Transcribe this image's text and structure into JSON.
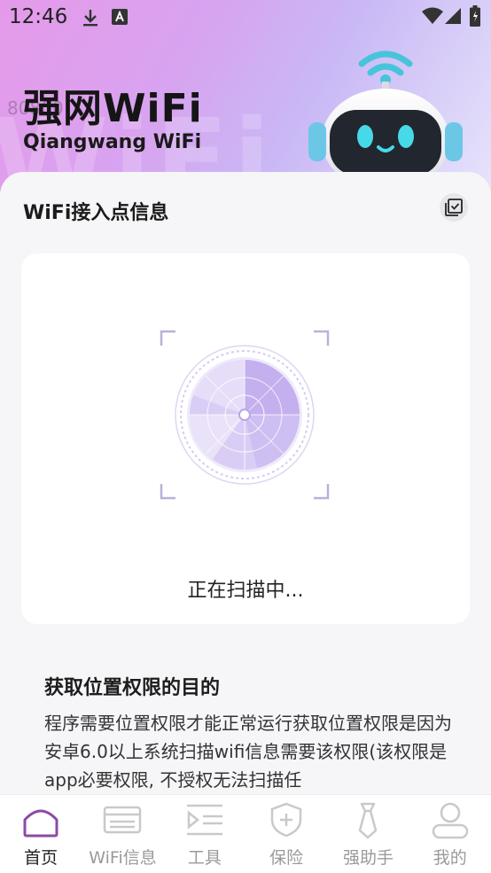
{
  "status_bar": {
    "time": "12:46"
  },
  "header": {
    "title": "强网WiFi",
    "subtitle": "Qiangwang WiFi",
    "faint_text": "80800"
  },
  "section": {
    "title": "WiFi接入点信息"
  },
  "scan": {
    "status_text": "正在扫描中..."
  },
  "permission": {
    "title": "获取位置权限的目的",
    "body": "程序需要位置权限才能正常运行获取位置权限是因为安卓6.0以上系统扫描wifi信息需要该权限(该权限是app必要权限, 不授权无法扫描任"
  },
  "tabs": [
    {
      "label": "首页",
      "icon": "home-icon"
    },
    {
      "label": "WiFi信息",
      "icon": "wifi-info-icon"
    },
    {
      "label": "工具",
      "icon": "tools-icon"
    },
    {
      "label": "保险",
      "icon": "shield-icon"
    },
    {
      "label": "强助手",
      "icon": "tie-icon"
    },
    {
      "label": "我的",
      "icon": "profile-icon"
    }
  ],
  "colors": {
    "accent": "#8b4aa8",
    "hero_start": "#e59ae9",
    "hero_end": "#e8e6fb",
    "scan_purple": "#c7b3f0"
  }
}
